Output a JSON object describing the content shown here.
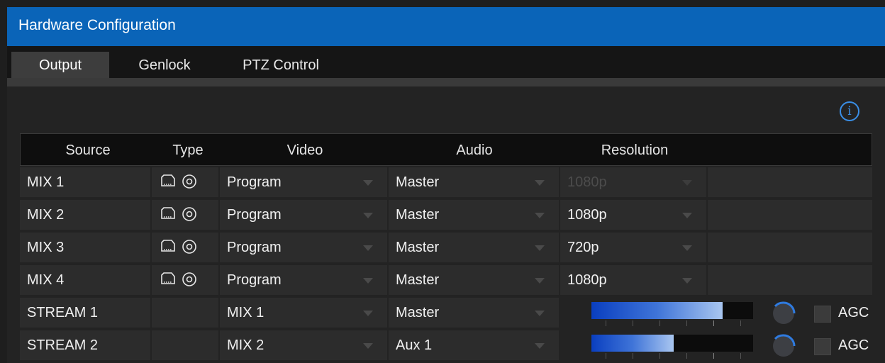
{
  "window": {
    "title": "Hardware Configuration"
  },
  "tabs": [
    {
      "label": "Output",
      "active": true
    },
    {
      "label": "Genlock",
      "active": false
    },
    {
      "label": "PTZ Control",
      "active": false
    }
  ],
  "table": {
    "headers": {
      "source": "Source",
      "type": "Type",
      "video": "Video",
      "audio": "Audio",
      "resolution": "Resolution"
    },
    "rows": [
      {
        "source": "MIX 1",
        "video": "Program",
        "audio": "Master",
        "resolution": "1080p",
        "resolution_enabled": false
      },
      {
        "source": "MIX 2",
        "video": "Program",
        "audio": "Master",
        "resolution": "1080p",
        "resolution_enabled": true
      },
      {
        "source": "MIX 3",
        "video": "Program",
        "audio": "Master",
        "resolution": "720p",
        "resolution_enabled": true
      },
      {
        "source": "MIX 4",
        "video": "Program",
        "audio": "Master",
        "resolution": "1080p",
        "resolution_enabled": true
      },
      {
        "source": "STREAM 1",
        "video": "MIX 1",
        "audio": "Master",
        "level_fraction": 0.81,
        "agc_label": "AGC",
        "agc_checked": false
      },
      {
        "source": "STREAM 2",
        "video": "MIX 2",
        "audio": "Aux 1",
        "level_fraction": 0.51,
        "agc_label": "AGC",
        "agc_checked": false
      }
    ]
  },
  "icons": {
    "info": "info-icon",
    "type_a": "ndi-output-icon",
    "type_b": "record-output-icon"
  },
  "colors": {
    "title_bar": "#0a64b8",
    "accent": "#3a8ee6",
    "meter_start": "#0a3fc0",
    "meter_end": "#a9c6f0"
  }
}
